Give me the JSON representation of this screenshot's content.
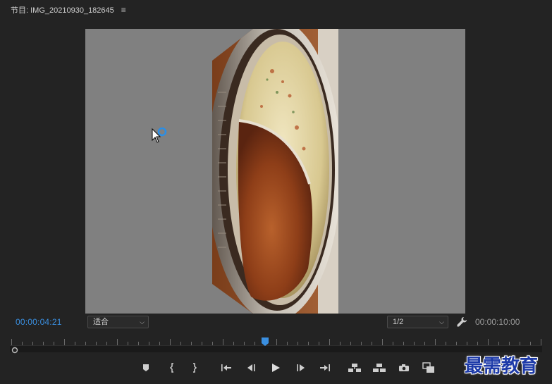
{
  "panel": {
    "title": "节目: IMG_20210930_182645",
    "menu_icon": "hamburger-menu-icon"
  },
  "timecode": {
    "current": "00:00:04:21",
    "duration": "00:00:10:00"
  },
  "zoom": {
    "selected": "适合"
  },
  "resolution": {
    "selected": "1/2"
  },
  "playhead_fraction": 0.48,
  "controls": [
    {
      "name": "add-marker-button",
      "icon": "marker-icon"
    },
    {
      "name": "mark-in-button",
      "icon": "mark-in-icon"
    },
    {
      "name": "mark-out-button",
      "icon": "mark-out-icon"
    },
    {
      "name": "go-to-in-button",
      "icon": "go-to-in-icon"
    },
    {
      "name": "step-back-button",
      "icon": "step-back-icon"
    },
    {
      "name": "play-button",
      "icon": "play-icon"
    },
    {
      "name": "step-forward-button",
      "icon": "step-forward-icon"
    },
    {
      "name": "go-to-out-button",
      "icon": "go-to-out-icon"
    },
    {
      "name": "lift-button",
      "icon": "lift-icon"
    },
    {
      "name": "extract-button",
      "icon": "extract-icon"
    },
    {
      "name": "export-frame-button",
      "icon": "camera-icon"
    },
    {
      "name": "comparison-view-button",
      "icon": "comparison-view-icon"
    }
  ],
  "watermark": "最需教育",
  "colors": {
    "background": "#232323",
    "canvas": "#808080",
    "accent": "#3a8fe0"
  }
}
